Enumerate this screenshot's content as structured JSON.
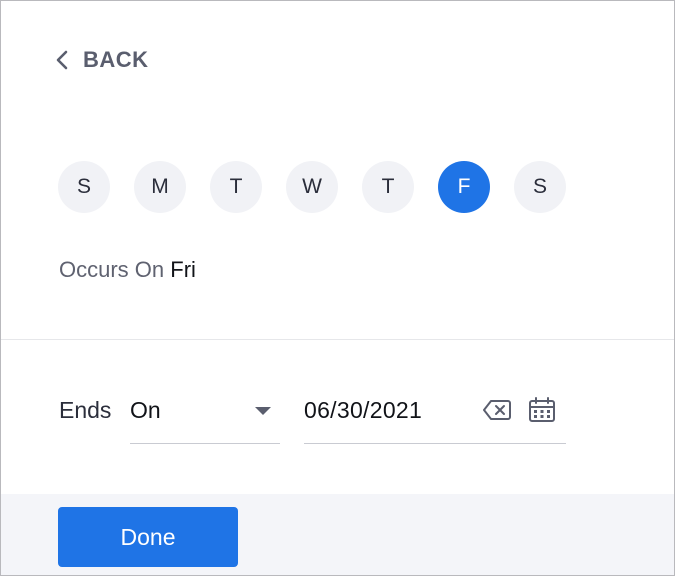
{
  "header": {
    "back_label": "BACK",
    "back_icon": "chevron-left-icon"
  },
  "weekdays": {
    "days": [
      {
        "label": "S",
        "selected": false
      },
      {
        "label": "M",
        "selected": false
      },
      {
        "label": "T",
        "selected": false
      },
      {
        "label": "W",
        "selected": false
      },
      {
        "label": "T",
        "selected": false
      },
      {
        "label": "F",
        "selected": true
      },
      {
        "label": "S",
        "selected": false
      }
    ],
    "selected_color": "#1f74e6",
    "unselected_color": "#f1f2f6"
  },
  "occurs": {
    "label": "Occurs On",
    "value": "Fri"
  },
  "ends": {
    "label": "Ends",
    "mode_value": "On",
    "date_value": "06/30/2021",
    "clear_icon": "backspace-clear-icon",
    "calendar_icon": "calendar-icon"
  },
  "footer": {
    "done_label": "Done"
  },
  "colors": {
    "accent": "#1f74e6"
  }
}
